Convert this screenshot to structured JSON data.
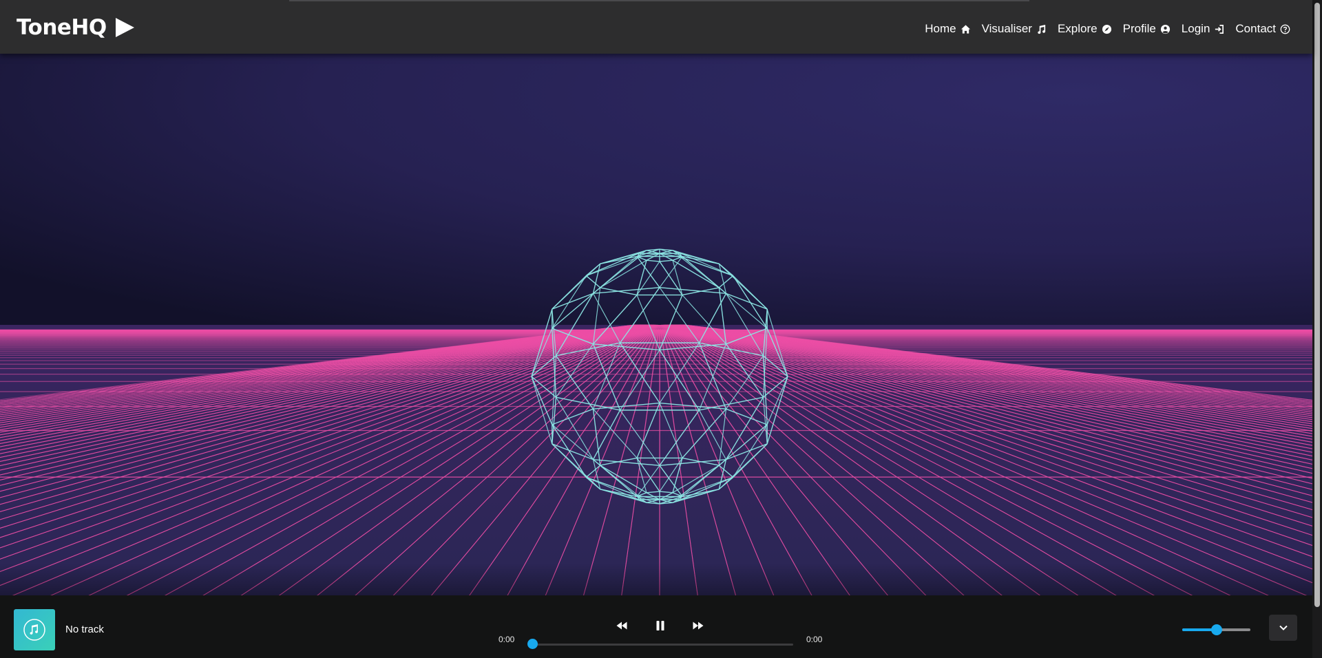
{
  "brand": {
    "name": "ToneHQ",
    "logo_icon": "play-icon"
  },
  "nav": [
    {
      "label": "Home",
      "icon": "home-icon"
    },
    {
      "label": "Visualiser",
      "icon": "music-note-icon"
    },
    {
      "label": "Explore",
      "icon": "compass-icon"
    },
    {
      "label": "Profile",
      "icon": "user-circle-icon"
    },
    {
      "label": "Login",
      "icon": "login-icon"
    },
    {
      "label": "Contact",
      "icon": "question-circle-icon"
    }
  ],
  "visualiser": {
    "sky_colors": [
      "#14122d",
      "#2d2862"
    ],
    "grid_color": "#ec4fa6",
    "sphere_color": "#8ce6e4"
  },
  "player": {
    "track_title": "No track",
    "album_icon": "music-note-icon",
    "current_time": "0:00",
    "total_time": "0:00",
    "progress": 0,
    "volume": 0.5,
    "accent_color": "#18a9ee",
    "controls": [
      "rewind-icon",
      "pause-icon",
      "fast-forward-icon"
    ],
    "collapse_icon": "chevron-down-icon"
  }
}
